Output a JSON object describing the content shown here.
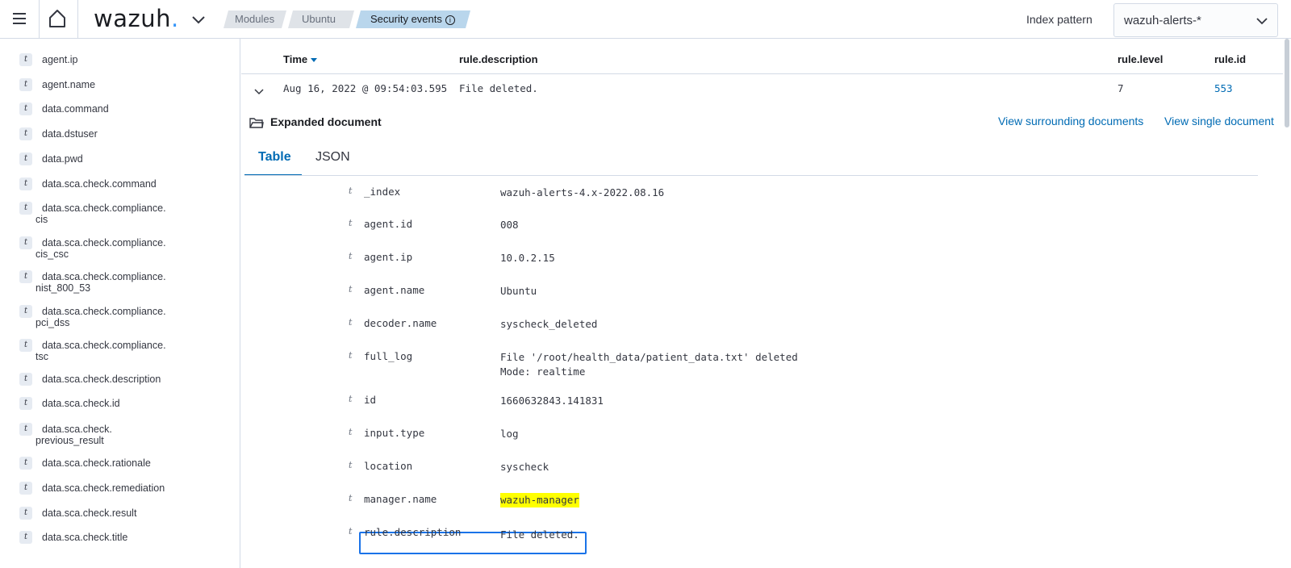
{
  "header": {
    "logo_text": "wazuh",
    "logo_dot": ".",
    "breadcrumbs": [
      "Modules",
      "Ubuntu",
      "Security events"
    ],
    "info_glyph": "i",
    "index_pattern_label": "Index pattern",
    "index_pattern_value": "wazuh-alerts-*"
  },
  "sidebar": {
    "token": "t",
    "fields": [
      {
        "a": "agent.ip",
        "b": ""
      },
      {
        "a": "agent.name",
        "b": ""
      },
      {
        "a": "data.command",
        "b": ""
      },
      {
        "a": "data.dstuser",
        "b": ""
      },
      {
        "a": "data.pwd",
        "b": ""
      },
      {
        "a": "data.sca.check.command",
        "b": ""
      },
      {
        "a": "data.sca.check.compliance.",
        "b": "cis"
      },
      {
        "a": "data.sca.check.compliance.",
        "b": "cis_csc"
      },
      {
        "a": "data.sca.check.compliance.",
        "b": "nist_800_53"
      },
      {
        "a": "data.sca.check.compliance.",
        "b": "pci_dss"
      },
      {
        "a": "data.sca.check.compliance.",
        "b": "tsc"
      },
      {
        "a": "data.sca.check.description",
        "b": ""
      },
      {
        "a": "data.sca.check.id",
        "b": ""
      },
      {
        "a": "data.sca.check.",
        "b": "previous_result"
      },
      {
        "a": "data.sca.check.rationale",
        "b": ""
      },
      {
        "a": "data.sca.check.remediation",
        "b": ""
      },
      {
        "a": "data.sca.check.result",
        "b": ""
      },
      {
        "a": "data.sca.check.title",
        "b": ""
      }
    ]
  },
  "table": {
    "columns": {
      "time": "Time",
      "description": "rule.description",
      "level": "rule.level",
      "id": "rule.id"
    },
    "row": {
      "time": "Aug 16, 2022 @ 09:54:03.595",
      "description": "File deleted.",
      "level": "7",
      "id": "553"
    }
  },
  "expanded": {
    "title": "Expanded document",
    "view_surrounding": "View surrounding documents",
    "view_single": "View single document",
    "tabs": [
      "Table",
      "JSON"
    ],
    "token": "t",
    "fields": [
      {
        "key": "_index",
        "value": "wazuh-alerts-4.x-2022.08.16",
        "value2": ""
      },
      {
        "key": "agent.id",
        "value": "008",
        "value2": ""
      },
      {
        "key": "agent.ip",
        "value": "10.0.2.15",
        "value2": ""
      },
      {
        "key": "agent.name",
        "value": "Ubuntu",
        "value2": ""
      },
      {
        "key": "decoder.name",
        "value": "syscheck_deleted",
        "value2": ""
      },
      {
        "key": "full_log",
        "value": "File '/root/health_data/patient_data.txt' deleted",
        "value2": "Mode: realtime"
      },
      {
        "key": "id",
        "value": "1660632843.141831",
        "value2": ""
      },
      {
        "key": "input.type",
        "value": "log",
        "value2": ""
      },
      {
        "key": "location",
        "value": "syscheck",
        "value2": ""
      },
      {
        "key": "manager.name",
        "value": "wazuh-manager",
        "value2": ""
      },
      {
        "key": "rule.description",
        "value": "File deleted.",
        "value2": ""
      }
    ]
  },
  "colors": {
    "accent": "#006bb4",
    "highlight": "#ffff00",
    "focus": "#1a73e8"
  }
}
